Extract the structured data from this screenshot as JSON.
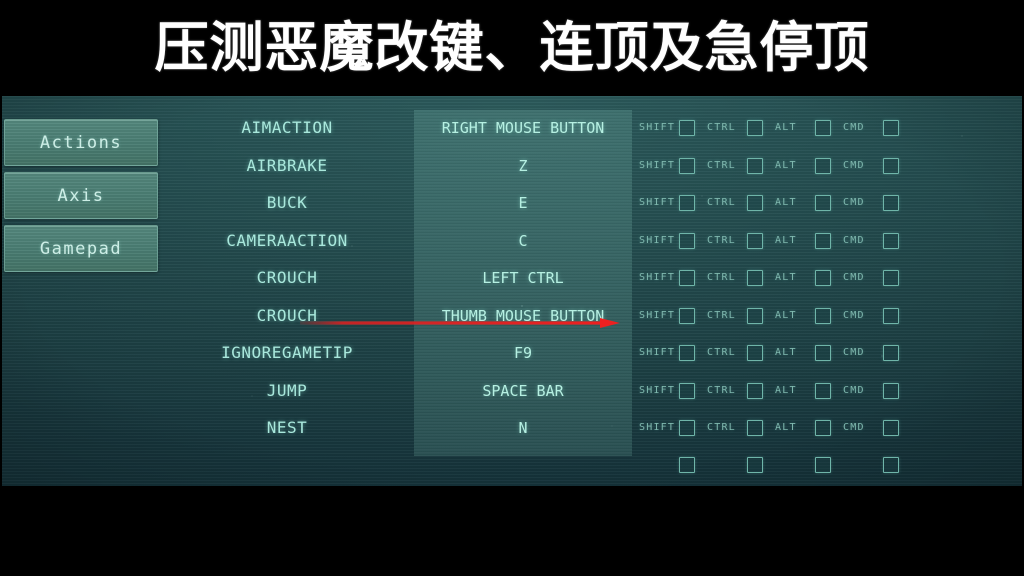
{
  "overlay": {
    "title": "压测恶魔改键、连顶及急停顶"
  },
  "colors": {
    "background_dark": "#15333a",
    "panel_teal": "#2e6258",
    "button_teal": "#4e8379",
    "text_cyan": "#a9e8dc",
    "arrow_red": "#e02020",
    "letterbox": "#000000"
  },
  "sidebar": {
    "items": [
      {
        "label": "Actions"
      },
      {
        "label": "Axis"
      },
      {
        "label": "Gamepad"
      }
    ]
  },
  "modifiers": {
    "labels": [
      "SHIFT",
      "CTRL",
      "ALT",
      "CMD"
    ],
    "checked": false
  },
  "bindings": {
    "rows": [
      {
        "action": "AIMACTION",
        "bind": "RIGHT MOUSE BUTTON"
      },
      {
        "action": "AIRBRAKE",
        "bind": "Z"
      },
      {
        "action": "BUCK",
        "bind": "E"
      },
      {
        "action": "CAMERAACTION",
        "bind": "C"
      },
      {
        "action": "CROUCH",
        "bind": "LEFT CTRL"
      },
      {
        "action": "CROUCH",
        "bind": "THUMB MOUSE BUTTON"
      },
      {
        "action": "IGNOREGAMETIP",
        "bind": "F9"
      },
      {
        "action": "JUMP",
        "bind": "SPACE BAR"
      },
      {
        "action": "NEST",
        "bind": "N"
      }
    ]
  },
  "annotation": {
    "arrow_color": "#e02020",
    "arrow_direction": "right"
  }
}
